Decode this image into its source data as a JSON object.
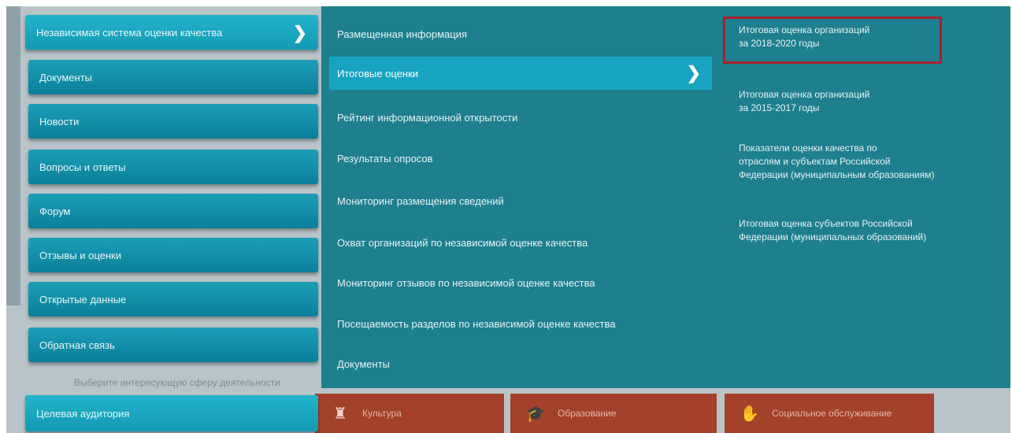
{
  "left_menu": {
    "active": {
      "label": "Независимая система оценки качества"
    },
    "items": [
      {
        "label": "Документы"
      },
      {
        "label": "Новости"
      },
      {
        "label": "Вопросы и ответы"
      },
      {
        "label": "Форум"
      },
      {
        "label": "Отзывы и оценки"
      },
      {
        "label": "Открытые данные"
      },
      {
        "label": "Обратная связь"
      }
    ],
    "bottom": {
      "label": "Целевая аудитория"
    }
  },
  "submenu": {
    "items": [
      {
        "label": "Размещенная информация"
      },
      {
        "label": "Итоговые оценки"
      },
      {
        "label": "Рейтинг информационной открытости"
      },
      {
        "label": "Результаты опросов"
      },
      {
        "label": "Мониторинг размещения сведений"
      },
      {
        "label": "Охват организаций по независимой оценке качества"
      },
      {
        "label": "Мониторинг отзывов по независимой оценке качества"
      },
      {
        "label": "Посещаемость разделов по независимой оценке качества"
      },
      {
        "label": "Документы"
      }
    ]
  },
  "third_menu": {
    "items": [
      {
        "line1": "Итоговая оценка организаций",
        "line2": "за 2018-2020 годы"
      },
      {
        "line1": "Итоговая оценка организаций",
        "line2": "за 2015-2017 годы"
      },
      {
        "line1": "Показатели оценки качества по",
        "line2": "отраслям и субъектам Российской",
        "line3": "Федерации (муниципальным образованиям)"
      },
      {
        "line1": "Итоговая оценка субъектов Российской",
        "line2": "Федерации (муниципальных образований)"
      }
    ]
  },
  "background": {
    "hint": "Выберите интересующую сферу деятельности",
    "tiles": [
      {
        "label": "Культура",
        "icon": "theater-icon"
      },
      {
        "label": "Образование",
        "icon": "graduation-cap-icon"
      },
      {
        "label": "Социальное обслуживание",
        "icon": "hands-icon"
      }
    ]
  },
  "colors": {
    "overlay": "#1e7f8e",
    "button": "#0a7f99",
    "active": "#16a4c1",
    "highlight_border": "#a8222a"
  }
}
